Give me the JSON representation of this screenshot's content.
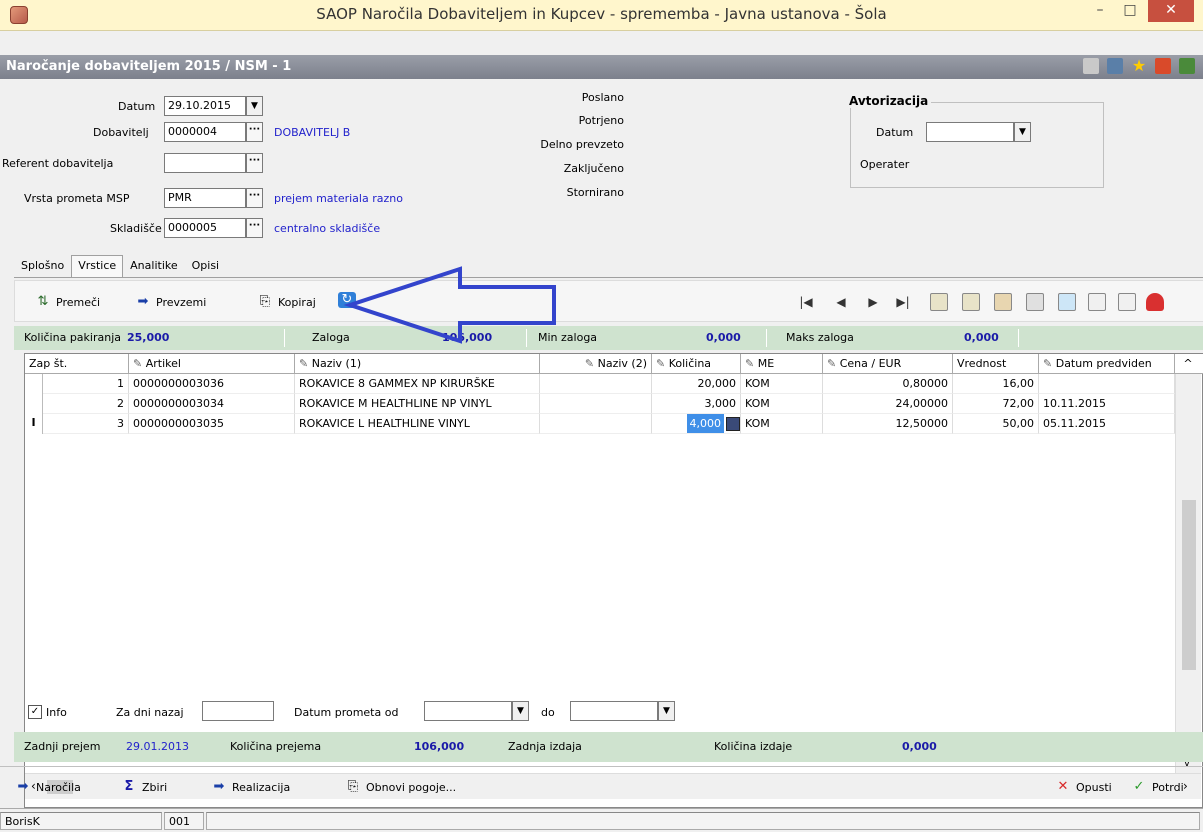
{
  "window": {
    "title": "SAOP  Naročila Dobaviteljem in Kupcev - sprememba - Javna ustanova - Šola",
    "minimize": "–",
    "maximize": "□",
    "close": "✕"
  },
  "subheader": {
    "title": "Naročanje dobaviteljem 2015 / NSM - 1"
  },
  "form": {
    "datum_label": "Datum",
    "datum_value": "29.10.2015",
    "dobavitelj_label": "Dobavitelj",
    "dobavitelj_value": "0000004",
    "dobavitelj_name": "DOBAVITELJ  B",
    "referent_label": "Referent dobavitelja",
    "referent_value": "",
    "vrsta_label": "Vrsta prometa MSP",
    "vrsta_value": "PMR",
    "vrsta_name": "prejem materiala razno",
    "skladisce_label": "Skladišče",
    "skladisce_value": "0000005",
    "skladisce_name": "centralno skladišče"
  },
  "status": {
    "poslano": "Poslano",
    "potrjeno": "Potrjeno",
    "delno": "Delno prevzeto",
    "zakljuceno": "Zaključeno",
    "stornirano": "Stornirano"
  },
  "authorization": {
    "title": "Avtorizacija",
    "datum_label": "Datum",
    "datum_value": "",
    "operater_label": "Operater"
  },
  "tabs": [
    "Splošno",
    "Vrstice",
    "Analitike",
    "Opisi"
  ],
  "toolbar": {
    "premeci": "Premeči",
    "prevzemi": "Prevzemi",
    "kopiraj": "Kopiraj"
  },
  "infobar": {
    "kolicina_pak_label": "Količina pakiranja",
    "kolicina_pak_value": "25,000",
    "zaloga_label": "Zaloga",
    "zaloga_value": "106,000",
    "min_label": "Min zaloga",
    "min_value": "0,000",
    "maks_label": "Maks zaloga",
    "maks_value": "0,000"
  },
  "grid": {
    "columns": [
      "Zap št.",
      "Artikel",
      "Naziv (1)",
      "Naziv (2)",
      "Količina",
      "ME",
      "Cena / EUR",
      "Vrednost",
      "Datum predviden"
    ],
    "rows": [
      {
        "zap": "1",
        "artikel": "0000000003036",
        "naziv1": "ROKAVICE 8 GAMMEX NP KIRURŠKE",
        "naziv2": "",
        "kolicina": "20,000",
        "me": "KOM",
        "cena": "0,80000",
        "vrednost": "16,00",
        "datum": ""
      },
      {
        "zap": "2",
        "artikel": "0000000003034",
        "naziv1": "ROKAVICE M HEALTHLINE NP VINYL",
        "naziv2": "",
        "kolicina": "3,000",
        "me": "KOM",
        "cena": "24,00000",
        "vrednost": "72,00",
        "datum": "10.11.2015"
      },
      {
        "zap": "3",
        "artikel": "0000000003035",
        "naziv1": "ROKAVICE L HEALTHLINE  VINYL",
        "naziv2": "",
        "kolicina": "4,000",
        "me": "KOM",
        "cena": "12,50000",
        "vrednost": "50,00",
        "datum": "05.11.2015"
      }
    ],
    "row_cursor": "I"
  },
  "filter": {
    "info_label": "Info",
    "za_dni_label": "Za dni nazaj",
    "za_dni_value": "",
    "datum_od_label": "Datum prometa od",
    "datum_od_value": "",
    "do_label": "do",
    "do_value": ""
  },
  "infobar2": {
    "zadnji_prejem_label": "Zadnji prejem",
    "zadnji_prejem_value": "29.01.2013",
    "kolicina_prejema_label": "Količina prejema",
    "kolicina_prejema_value": "106,000",
    "zadnja_izdaja_label": "Zadnja izdaja",
    "kolicina_izdaje_label": "Količina izdaje",
    "kolicina_izdaje_value": "0,000"
  },
  "bottom": {
    "narocila": "Naročila",
    "zbiri": "Zbiri",
    "realizacija": "Realizacija",
    "obnovi": "Obnovi pogoje...",
    "opusti": "Opusti",
    "potrdi": "Potrdi"
  },
  "statusbar": {
    "user": "BorisK",
    "code": "001"
  }
}
